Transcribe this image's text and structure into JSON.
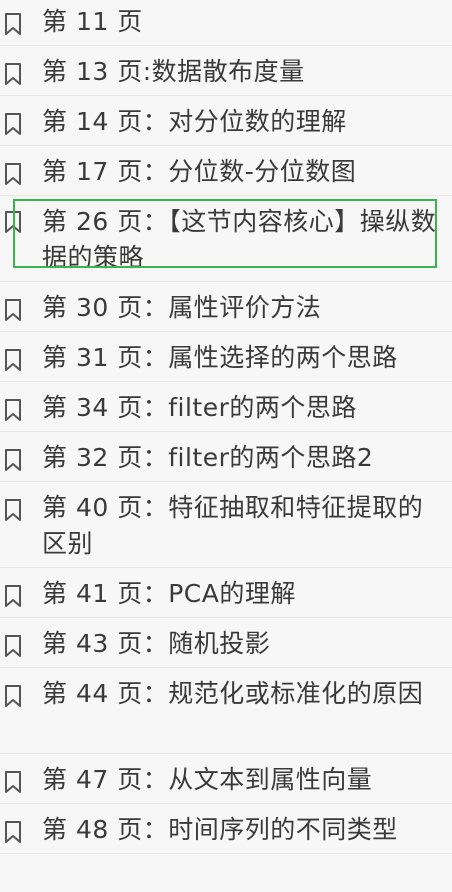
{
  "bookmarks": {
    "items": [
      {
        "label": "第 11 页"
      },
      {
        "label": "第 13 页:数据散布度量"
      },
      {
        "label": "第 14 页：对分位数的理解"
      },
      {
        "label": "第 17 页：分位数-分位数图"
      },
      {
        "label": "第 26 页：【这节内容核心】操纵数据的策略"
      },
      {
        "label": "第 30 页：属性评价方法"
      },
      {
        "label": "第 31 页：属性选择的两个思路"
      },
      {
        "label": "第 34 页：filter的两个思路"
      },
      {
        "label": "第 32 页：filter的两个思路2"
      },
      {
        "label": "第 40 页：特征抽取和特征提取的区别"
      },
      {
        "label": "第 41 页：PCA的理解"
      },
      {
        "label": "第 43 页：随机投影"
      },
      {
        "label": "第 44 页：规范化或标准化的原因"
      },
      {
        "label": "第 47 页：从文本到属性向量"
      },
      {
        "label": "第 48 页：时间序列的不同类型"
      }
    ]
  },
  "colors": {
    "background": "#f7f7f7",
    "text": "#3a3a3a",
    "icon": "#555555",
    "divider": "#e6e6e6",
    "highlight": "#3bb54a"
  },
  "icons": {
    "bookmark": "bookmark-icon"
  }
}
